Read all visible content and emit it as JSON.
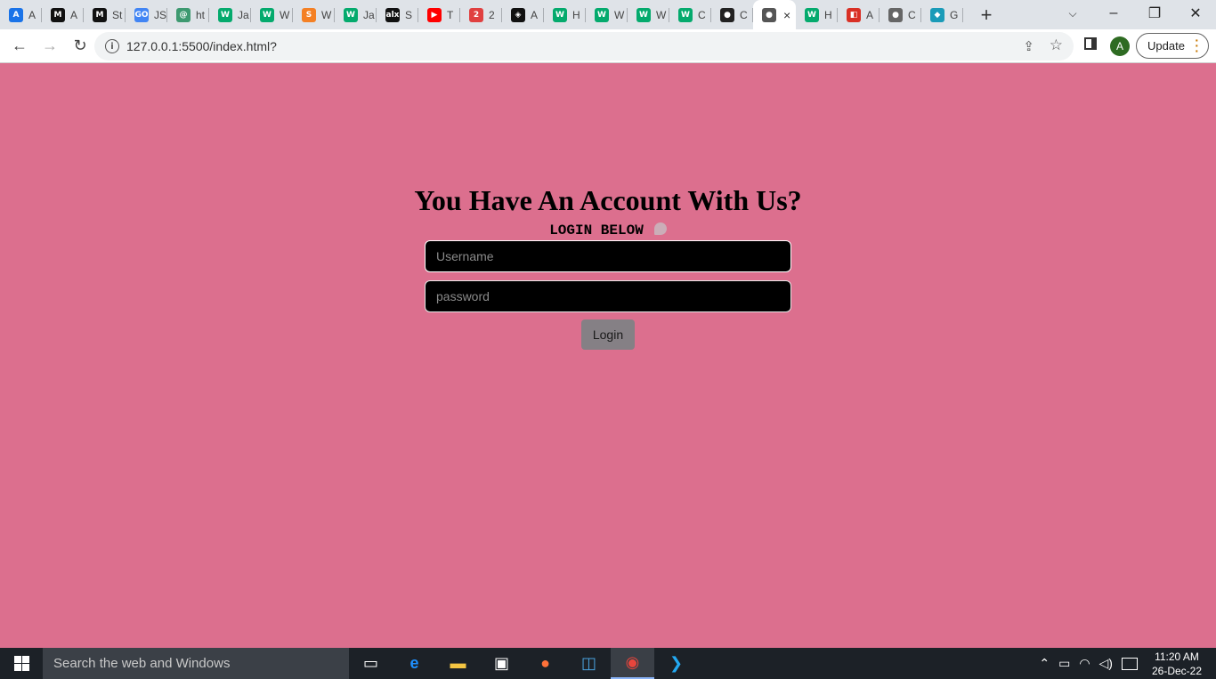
{
  "browser": {
    "tabs": [
      {
        "icon": "A",
        "icon_color": "#1a73e8",
        "label": "A"
      },
      {
        "icon": "M",
        "icon_color": "#111111",
        "label": "A"
      },
      {
        "icon": "M",
        "icon_color": "#111111",
        "label": "St"
      },
      {
        "icon": "GO",
        "icon_color": "#4285f4",
        "label": "JS"
      },
      {
        "icon": "@",
        "icon_color": "#3d9970",
        "label": "ht"
      },
      {
        "icon": "W",
        "icon_color": "#04aa6d",
        "label": "Ja"
      },
      {
        "icon": "W",
        "icon_color": "#04aa6d",
        "label": "W"
      },
      {
        "icon": "S",
        "icon_color": "#f48024",
        "label": "W"
      },
      {
        "icon": "W",
        "icon_color": "#04aa6d",
        "label": "Ja"
      },
      {
        "icon": "alx",
        "icon_color": "#111111",
        "label": "S"
      },
      {
        "icon": "▶",
        "icon_color": "#ff0000",
        "label": "T"
      },
      {
        "icon": "2",
        "icon_color": "#e04040",
        "label": "2"
      },
      {
        "icon": "◈",
        "icon_color": "#111111",
        "label": "A"
      },
      {
        "icon": "W",
        "icon_color": "#04aa6d",
        "label": "H"
      },
      {
        "icon": "W",
        "icon_color": "#04aa6d",
        "label": "W"
      },
      {
        "icon": "W",
        "icon_color": "#04aa6d",
        "label": "W"
      },
      {
        "icon": "W",
        "icon_color": "#04aa6d",
        "label": "C"
      },
      {
        "icon": "●",
        "icon_color": "#222222",
        "label": "C"
      }
    ],
    "active_tab": {
      "icon": "●",
      "icon_color": "#555555",
      "close": "×"
    },
    "tabs_after": [
      {
        "icon": "W",
        "icon_color": "#04aa6d",
        "label": "H"
      },
      {
        "icon": "◧",
        "icon_color": "#d93025",
        "label": "A"
      },
      {
        "icon": "●",
        "icon_color": "#666666",
        "label": "C"
      },
      {
        "icon": "◆",
        "icon_color": "#1a9bb8",
        "label": "G"
      }
    ],
    "new_tab": "+",
    "url": "127.0.0.1:5500/index.html?",
    "profile_initial": "A",
    "update_label": "Update"
  },
  "page": {
    "background": "#dc6f8e",
    "heading": "You Have An Account With Us?",
    "subheading": "LOGIN BELOW",
    "username_placeholder": "Username",
    "password_placeholder": "password",
    "login_label": "Login"
  },
  "taskbar": {
    "search_placeholder": "Search the web and Windows",
    "time": "11:20 AM",
    "date": "26-Dec-22"
  }
}
